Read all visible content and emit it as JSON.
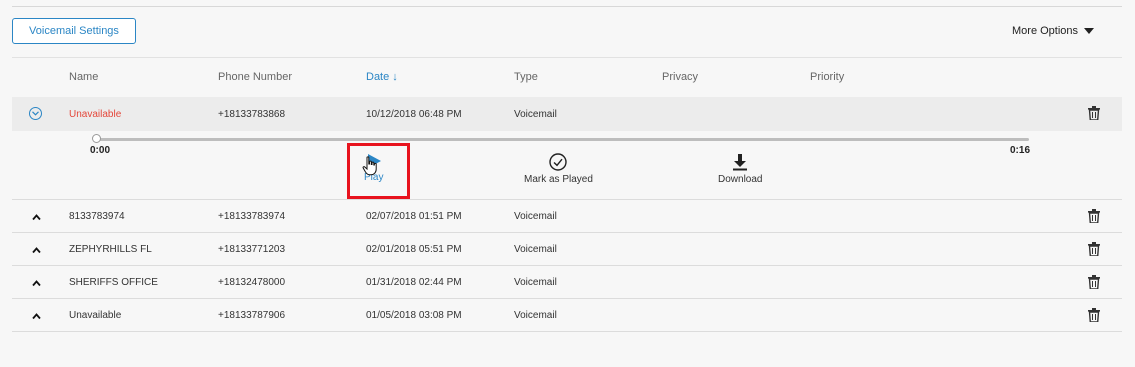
{
  "toolbar": {
    "voicemail_settings_label": "Voicemail Settings",
    "more_options_label": "More Options"
  },
  "table": {
    "headers": {
      "name": "Name",
      "phone": "Phone Number",
      "date": "Date ↓",
      "type": "Type",
      "privacy": "Privacy",
      "priority": "Priority"
    },
    "selected_row": {
      "name": "Unavailable",
      "phone": "+18133783868",
      "date": "10/12/2018 06:48 PM",
      "type": "Voicemail"
    },
    "rows": [
      {
        "name": "8133783974",
        "phone": "+18133783974",
        "date": "02/07/2018 01:51 PM",
        "type": "Voicemail"
      },
      {
        "name": "ZEPHYRHILLS FL",
        "phone": "+18133771203",
        "date": "02/01/2018 05:51 PM",
        "type": "Voicemail"
      },
      {
        "name": "SHERIFFS OFFICE",
        "phone": "+18132478000",
        "date": "01/31/2018 02:44 PM",
        "type": "Voicemail"
      },
      {
        "name": "Unavailable",
        "phone": "+18133787906",
        "date": "01/05/2018 03:08 PM",
        "type": "Voicemail"
      }
    ]
  },
  "player": {
    "current_time": "0:00",
    "duration": "0:16",
    "progress": 0,
    "play_label": "Play",
    "mark_played_label": "Mark as Played",
    "download_label": "Download"
  },
  "colors": {
    "accent": "#2b86c5",
    "alert_red": "#e4473a",
    "highlight_box": "#e8131e"
  },
  "icons": {
    "expand": "chevron-down-circle-icon",
    "collapse": "chevron-up-icon",
    "delete": "trash-icon",
    "play": "play-icon",
    "mark_played": "check-circle-icon",
    "download": "download-icon"
  }
}
